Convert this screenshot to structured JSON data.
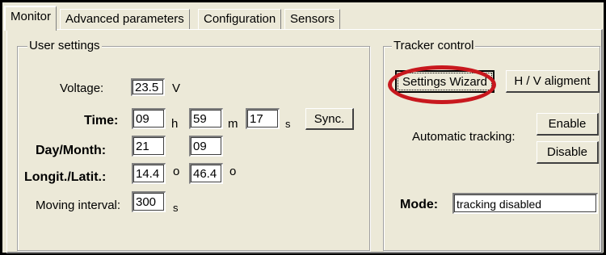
{
  "tabs": [
    {
      "label": "Monitor"
    },
    {
      "label": "Advanced parameters"
    },
    {
      "label": "Configuration"
    },
    {
      "label": "Sensors"
    }
  ],
  "user_settings": {
    "title": "User settings",
    "voltage": {
      "label": "Voltage:",
      "value": "23.5",
      "unit": "V"
    },
    "time": {
      "label": "Time:",
      "hours": "09",
      "h": "h",
      "minutes": "59",
      "m": "m",
      "seconds": "17",
      "s": "s"
    },
    "sync_label": "Sync.",
    "day_month": {
      "label": "Day/Month:",
      "day": "21",
      "month": "09"
    },
    "longit_latit": {
      "label": "Longit./Latit.:",
      "longitude": "14.4",
      "lon_unit": "o",
      "latitude": "46.4",
      "lat_unit": "o"
    },
    "moving_interval": {
      "label": "Moving interval:",
      "value": "300",
      "unit": "s"
    }
  },
  "tracker_control": {
    "title": "Tracker control",
    "settings_wizard_label": "Settings Wizard",
    "hv_alignment_label": "H / V aligment",
    "automatic_tracking_label": "Automatic tracking:",
    "enable_label": "Enable",
    "disable_label": "Disable",
    "mode_label": "Mode:",
    "mode_value": "tracking disabled"
  },
  "colors": {
    "highlight": "#c8181e",
    "window_bg": "#ece9d8"
  }
}
